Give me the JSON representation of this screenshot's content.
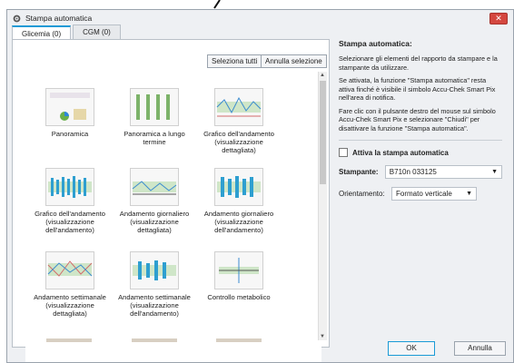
{
  "window": {
    "title": "Stampa automatica",
    "close_label": "✕"
  },
  "tabs": [
    {
      "label": "Glicemia (0)"
    },
    {
      "label": "CGM (0)"
    }
  ],
  "toolbar": {
    "select_all": "Seleziona tutti",
    "deselect": "Annulla selezione"
  },
  "items": [
    {
      "label": "Panoramica"
    },
    {
      "label": "Panoramica a lungo termine"
    },
    {
      "label": "Grafico dell'andamento (visualizzazione dettagliata)"
    },
    {
      "label": "Grafico dell'andamento (visualizzazione dell'andamento)"
    },
    {
      "label": "Andamento giornaliero (visualizzazione dettagliata)"
    },
    {
      "label": "Andamento giornaliero (visualizzazione dell'andamento)"
    },
    {
      "label": "Andamento settimanale (visualizzazione dettagliata)"
    },
    {
      "label": "Andamento settimanale (visualizzazione dell'andamento)"
    },
    {
      "label": "Controllo metabolico"
    }
  ],
  "right": {
    "heading": "Stampa automatica:",
    "p1": "Selezionare gli elementi del rapporto da stampare e la stampante da utilizzare.",
    "p2": "Se attivata, la funzione \"Stampa automatica\" resta attiva finché è visibile il simbolo Accu-Chek Smart Pix nell'area di notifica.",
    "p3": "Fare clic con il pulsante destro del mouse sul simbolo Accu-Chek Smart Pix e selezionare \"Chiudi\" per disattivare la funzione \"Stampa automatica\".",
    "checkbox_label": "Attiva la stampa automatica",
    "printer_label": "Stampante:",
    "printer_value": "B710n 033125",
    "orientation_label": "Orientamento:",
    "orientation_value": "Formato verticale"
  },
  "footer": {
    "ok": "OK",
    "cancel": "Annulla"
  }
}
